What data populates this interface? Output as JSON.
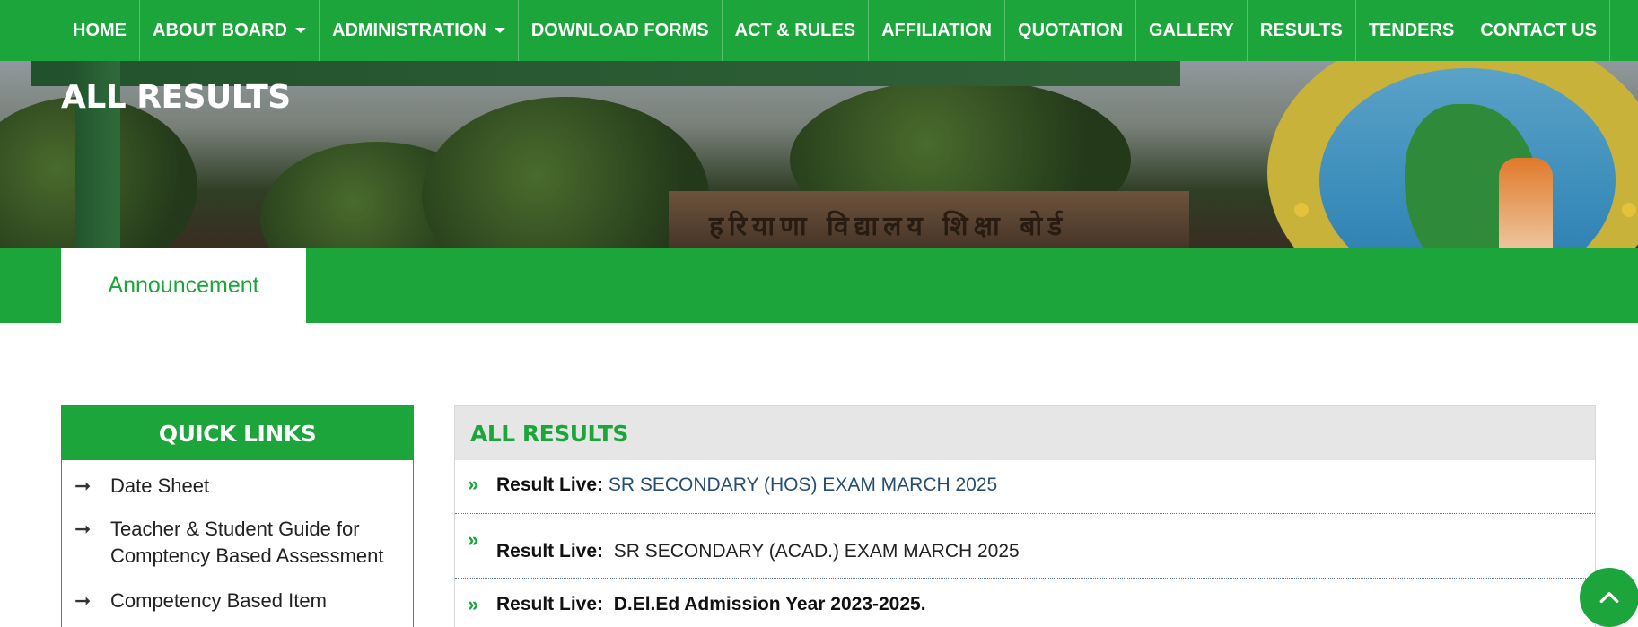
{
  "nav": {
    "items": [
      {
        "label": "HOME",
        "dropdown": false
      },
      {
        "label": "ABOUT BOARD",
        "dropdown": true
      },
      {
        "label": "ADMINISTRATION",
        "dropdown": true
      },
      {
        "label": "DOWNLOAD FORMS",
        "dropdown": false
      },
      {
        "label": "ACT & RULES",
        "dropdown": false
      },
      {
        "label": "AFFILIATION",
        "dropdown": false
      },
      {
        "label": "QUOTATION",
        "dropdown": false
      },
      {
        "label": "GALLERY",
        "dropdown": false
      },
      {
        "label": "RESULTS",
        "dropdown": false
      },
      {
        "label": "TENDERS",
        "dropdown": false
      },
      {
        "label": "CONTACT US",
        "dropdown": false
      }
    ]
  },
  "banner": {
    "title": "ALL RESULTS",
    "sign_text": "हरियाणा विद्यालय शिक्षा बोर्ड"
  },
  "tabs": {
    "active_label": "Announcement"
  },
  "quick_links": {
    "title": "QUICK LINKS",
    "items": [
      {
        "label": "Date Sheet"
      },
      {
        "label": "Teacher & Student Guide for Comptency Based Assessment"
      },
      {
        "label": "Competency Based Item"
      }
    ]
  },
  "results": {
    "title": "ALL RESULTS",
    "rows": [
      {
        "prefix": "Result Live:",
        "text": "SR SECONDARY (HOS) EXAM MARCH 2025"
      },
      {
        "prefix": "Result Live:",
        "text": "SR SECONDARY (ACAD.) EXAM MARCH 2025"
      },
      {
        "prefix": "Result Live:",
        "text": "D.El.Ed Admission Year 2023-2025."
      }
    ]
  },
  "colors": {
    "brand_green": "#1ba53a",
    "link_blue": "#264e72",
    "panel_header_gray": "#e6e6e6"
  },
  "icons": {
    "nav_dropdown": "caret-down-icon",
    "quick_link_bullet": "arrow-right-icon",
    "result_bullet": "double-chevron-right-icon",
    "scroll_top": "chevron-up-icon"
  }
}
